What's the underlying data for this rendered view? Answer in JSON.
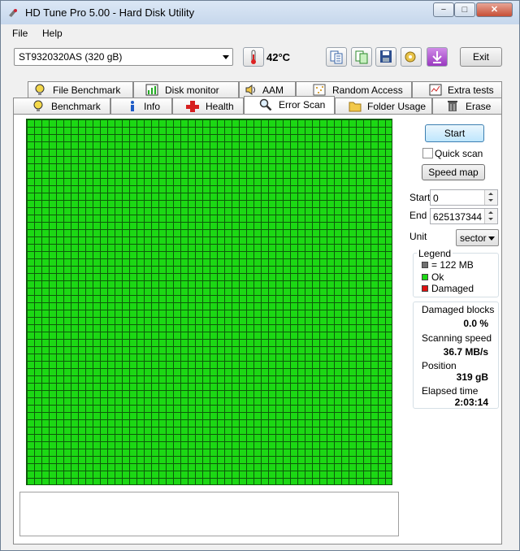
{
  "window": {
    "title": "HD Tune Pro 5.00 - Hard Disk Utility",
    "minimize_label": "−",
    "maximize_label": "□",
    "close_label": "✕"
  },
  "menu": {
    "items": [
      "File",
      "Help"
    ]
  },
  "toolbar": {
    "drive": "ST9320320AS (320 gB)",
    "temperature": "42°C",
    "exit_label": "Exit",
    "buttons": [
      "copy-info-icon",
      "copy-screenshot-icon",
      "save-icon",
      "options-icon",
      "download-icon"
    ]
  },
  "tabs": {
    "row1": [
      "File Benchmark",
      "Disk monitor",
      "AAM",
      "Random Access",
      "Extra tests"
    ],
    "row2": [
      "Benchmark",
      "Info",
      "Health",
      "Error Scan",
      "Folder Usage",
      "Erase"
    ],
    "active": "Error Scan"
  },
  "scan": {
    "start_label": "Start",
    "quick_scan_label": "Quick scan",
    "quick_scan_checked": false,
    "speed_map_label": "Speed map",
    "start_field_label": "Start",
    "start_value": "0",
    "end_field_label": "End",
    "end_value": "625137344",
    "unit_label": "Unit",
    "unit_value": "sector",
    "grid_status": "all blocks ok"
  },
  "legend": {
    "title": "Legend",
    "block_size": "= 122 MB",
    "ok": "Ok",
    "damaged": "Damaged",
    "colors": {
      "block": "#707070",
      "ok": "#1cd814",
      "damaged": "#e01010"
    }
  },
  "stats": {
    "damaged_blocks_label": "Damaged blocks",
    "damaged_blocks_value": "0.0 %",
    "scanning_speed_label": "Scanning speed",
    "scanning_speed_value": "36.7 MB/s",
    "position_label": "Position",
    "position_value": "319 gB",
    "elapsed_label": "Elapsed time",
    "elapsed_value": "2:03:14"
  }
}
